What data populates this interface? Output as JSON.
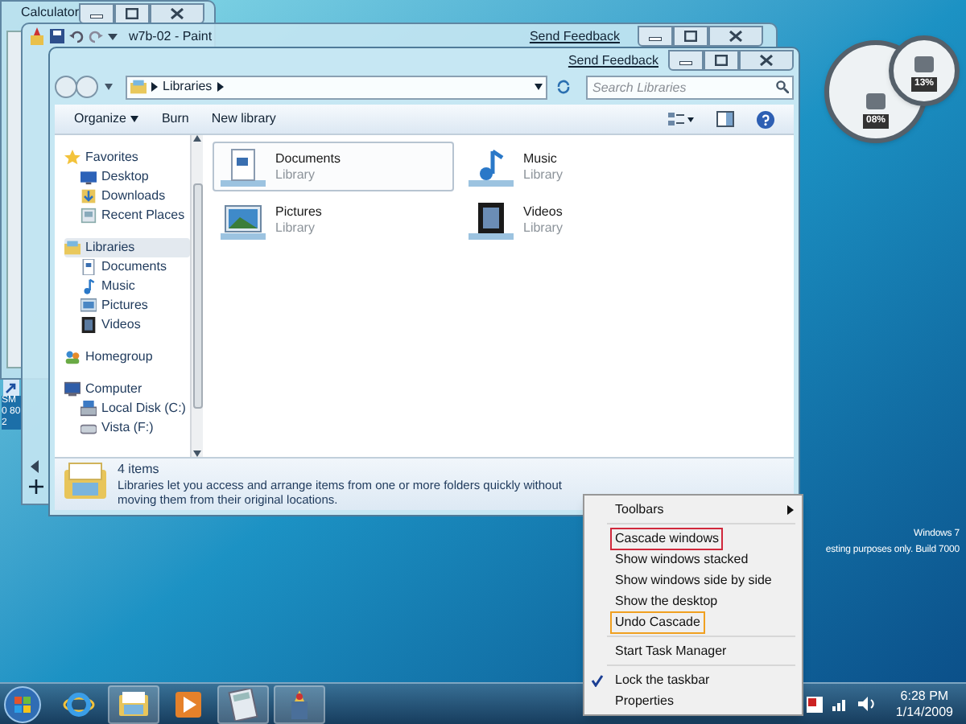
{
  "calculator_window": {
    "title": "Calculator"
  },
  "paint_window": {
    "title": "w7b-02 - Paint",
    "feedback_link": "Send Feedback"
  },
  "desktop_icons": [
    {
      "label": "SM0 802"
    }
  ],
  "explorer_window": {
    "feedback_link": "Send Feedback",
    "address": [
      "Libraries"
    ],
    "search": {
      "placeholder": "Search Libraries"
    },
    "toolbar": [
      {
        "label": "Organize",
        "kind": "dropdown"
      },
      {
        "label": "Burn",
        "kind": "button"
      },
      {
        "label": "New library",
        "kind": "button"
      }
    ],
    "navigation": [
      {
        "label": "Favorites",
        "kind": "star",
        "selected": false,
        "children": [
          {
            "label": "Desktop",
            "kind": "desktop",
            "selected": false
          },
          {
            "label": "Downloads",
            "kind": "download",
            "selected": false
          },
          {
            "label": "Recent Places",
            "kind": "recent",
            "selected": false
          }
        ]
      },
      {
        "label": "Libraries",
        "kind": "library",
        "selected": true,
        "children": [
          {
            "label": "Documents",
            "kind": "document",
            "selected": false
          },
          {
            "label": "Music",
            "kind": "music",
            "selected": false
          },
          {
            "label": "Pictures",
            "kind": "picture",
            "selected": false
          },
          {
            "label": "Videos",
            "kind": "video",
            "selected": false
          }
        ]
      },
      {
        "label": "Homegroup",
        "kind": "homegroup",
        "selected": false
      },
      {
        "label": "Computer",
        "kind": "computer",
        "selected": false,
        "children": [
          {
            "label": "Local Disk (C:)",
            "kind": "disk",
            "selected": false
          },
          {
            "label": "Vista (F:)",
            "kind": "drive",
            "selected": false
          }
        ]
      }
    ],
    "libraries": [
      {
        "name": "Documents",
        "subtitle": "Library",
        "kind": "document",
        "selected": true
      },
      {
        "name": "Music",
        "subtitle": "Library",
        "kind": "music",
        "selected": false
      },
      {
        "name": "Pictures",
        "subtitle": "Library",
        "kind": "picture",
        "selected": false
      },
      {
        "name": "Videos",
        "subtitle": "Library",
        "kind": "video",
        "selected": false
      }
    ],
    "details": {
      "count": "4 items",
      "description": "Libraries let you access and arrange items from one or more folders quickly without moving them from their original locations."
    }
  },
  "gadgets": [
    {
      "reading": "08%"
    },
    {
      "reading": "13%"
    }
  ],
  "build_info": [
    "Windows 7",
    "esting purposes only. Build 7000"
  ],
  "context_menu": [
    {
      "kind": "submenu",
      "label": "Toolbars",
      "checked": false
    },
    {
      "kind": "separator"
    },
    {
      "kind": "item",
      "label": "Cascade windows",
      "checked": false,
      "color": "#d0283c"
    },
    {
      "kind": "item",
      "label": "Show windows stacked",
      "checked": false
    },
    {
      "kind": "item",
      "label": "Show windows side by side",
      "checked": false
    },
    {
      "kind": "item",
      "label": "Show the desktop",
      "checked": false
    },
    {
      "kind": "item",
      "label": "Undo Cascade",
      "checked": false,
      "color": "#f0a020"
    },
    {
      "kind": "separator"
    },
    {
      "kind": "item",
      "label": "Start Task Manager",
      "checked": false
    },
    {
      "kind": "separator"
    },
    {
      "kind": "item",
      "label": "Lock the taskbar",
      "checked": true
    },
    {
      "kind": "item",
      "label": "Properties",
      "checked": false
    }
  ],
  "taskbar": {
    "apps": [
      {
        "kind": "ie",
        "running": false
      },
      {
        "kind": "explorer",
        "running": true
      },
      {
        "kind": "media",
        "running": false
      },
      {
        "kind": "calculator",
        "running": true
      },
      {
        "kind": "paint",
        "running": true
      }
    ],
    "clock": {
      "time": "6:28 PM",
      "date": "1/14/2009"
    }
  }
}
